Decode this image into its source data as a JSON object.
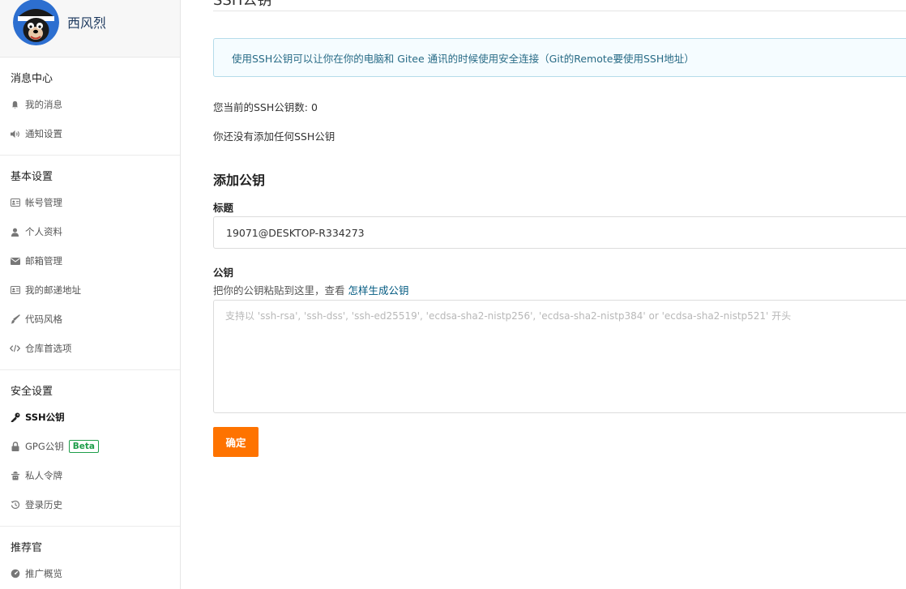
{
  "user": {
    "name": "西风烈"
  },
  "sidebar": {
    "groups": [
      {
        "title": "消息中心",
        "items": [
          {
            "label": "我的消息",
            "icon": "bell-icon"
          },
          {
            "label": "通知设置",
            "icon": "volume-icon"
          }
        ]
      },
      {
        "title": "基本设置",
        "items": [
          {
            "label": "帐号管理",
            "icon": "id-card-icon"
          },
          {
            "label": "个人资料",
            "icon": "user-icon"
          },
          {
            "label": "邮箱管理",
            "icon": "envelope-icon"
          },
          {
            "label": "我的邮递地址",
            "icon": "address-card-icon"
          },
          {
            "label": "代码风格",
            "icon": "brush-icon"
          },
          {
            "label": "仓库首选项",
            "icon": "code-icon"
          }
        ]
      },
      {
        "title": "安全设置",
        "items": [
          {
            "label": "SSH公钥",
            "icon": "key-icon",
            "active": true
          },
          {
            "label": "GPG公钥",
            "icon": "lock-icon",
            "badge": "Beta"
          },
          {
            "label": "私人令牌",
            "icon": "token-icon"
          },
          {
            "label": "登录历史",
            "icon": "history-icon"
          }
        ]
      },
      {
        "title": "推荐官",
        "items": [
          {
            "label": "推广概览",
            "icon": "dashboard-icon"
          }
        ]
      }
    ]
  },
  "main": {
    "page_title": "SSH公钥",
    "tip": "使用SSH公钥可以让你在你的电脑和 Gitee 通讯的时候使用安全连接（Git的Remote要使用SSH地址）",
    "key_count": "您当前的SSH公钥数: 0",
    "no_keys": "你还没有添加任何SSH公钥",
    "section_title": "添加公钥",
    "title_label": "标题",
    "title_value": "19071@DESKTOP-R334273",
    "key_label": "公钥",
    "key_hint": "把你的公钥粘贴到这里，查看",
    "key_hint_link": "怎样生成公钥",
    "key_placeholder": "支持以 'ssh-rsa', 'ssh-dss', 'ssh-ed25519', 'ecdsa-sha2-nistp256', 'ecdsa-sha2-nistp384' or 'ecdsa-sha2-nistp521' 开头",
    "confirm_label": "确定"
  },
  "colors": {
    "accent": "#fe7300",
    "link": "#005980",
    "badge": "#1e9e4a",
    "tip_bg": "#f5fcff",
    "tip_border": "#b5dcea"
  }
}
